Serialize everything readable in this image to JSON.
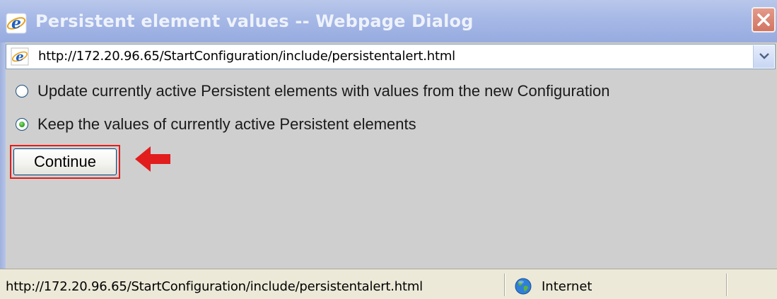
{
  "window": {
    "title": "Persistent element values -- Webpage Dialog",
    "close_icon": "close-icon"
  },
  "address_bar": {
    "url": "http://172.20.96.65/StartConfiguration/include/persistentalert.html",
    "page_icon": "ie-page-icon",
    "dropdown_icon": "chevron-down-icon"
  },
  "options": [
    {
      "label": "Update currently active Persistent elements with values from the new Configuration",
      "selected": false
    },
    {
      "label": "Keep the values of currently active Persistent elements",
      "selected": true
    }
  ],
  "continue_button": {
    "label": "Continue"
  },
  "annotation": {
    "arrow_icon": "red-arrow-left-icon",
    "color": "#e21d1d"
  },
  "status_bar": {
    "url": "http://172.20.96.65/StartConfiguration/include/persistentalert.html",
    "zone": "Internet",
    "zone_icon": "globe-icon"
  },
  "colors": {
    "title_bar": "#a6b8e6",
    "content_bg": "#cfcfcf",
    "status_bg": "#ece9d8"
  }
}
